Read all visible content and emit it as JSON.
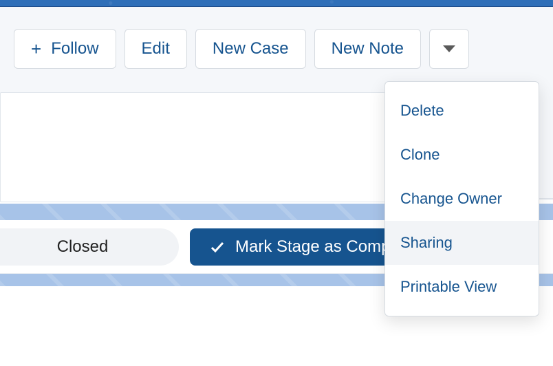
{
  "actions": {
    "follow": "Follow",
    "edit": "Edit",
    "new_case": "New Case",
    "new_note": "New Note"
  },
  "dropdown": {
    "items": [
      {
        "label": "Delete"
      },
      {
        "label": "Clone"
      },
      {
        "label": "Change Owner"
      },
      {
        "label": "Sharing"
      },
      {
        "label": "Printable View"
      }
    ]
  },
  "stage": {
    "closed": "Closed",
    "mark": "Mark Stage as Complete"
  }
}
